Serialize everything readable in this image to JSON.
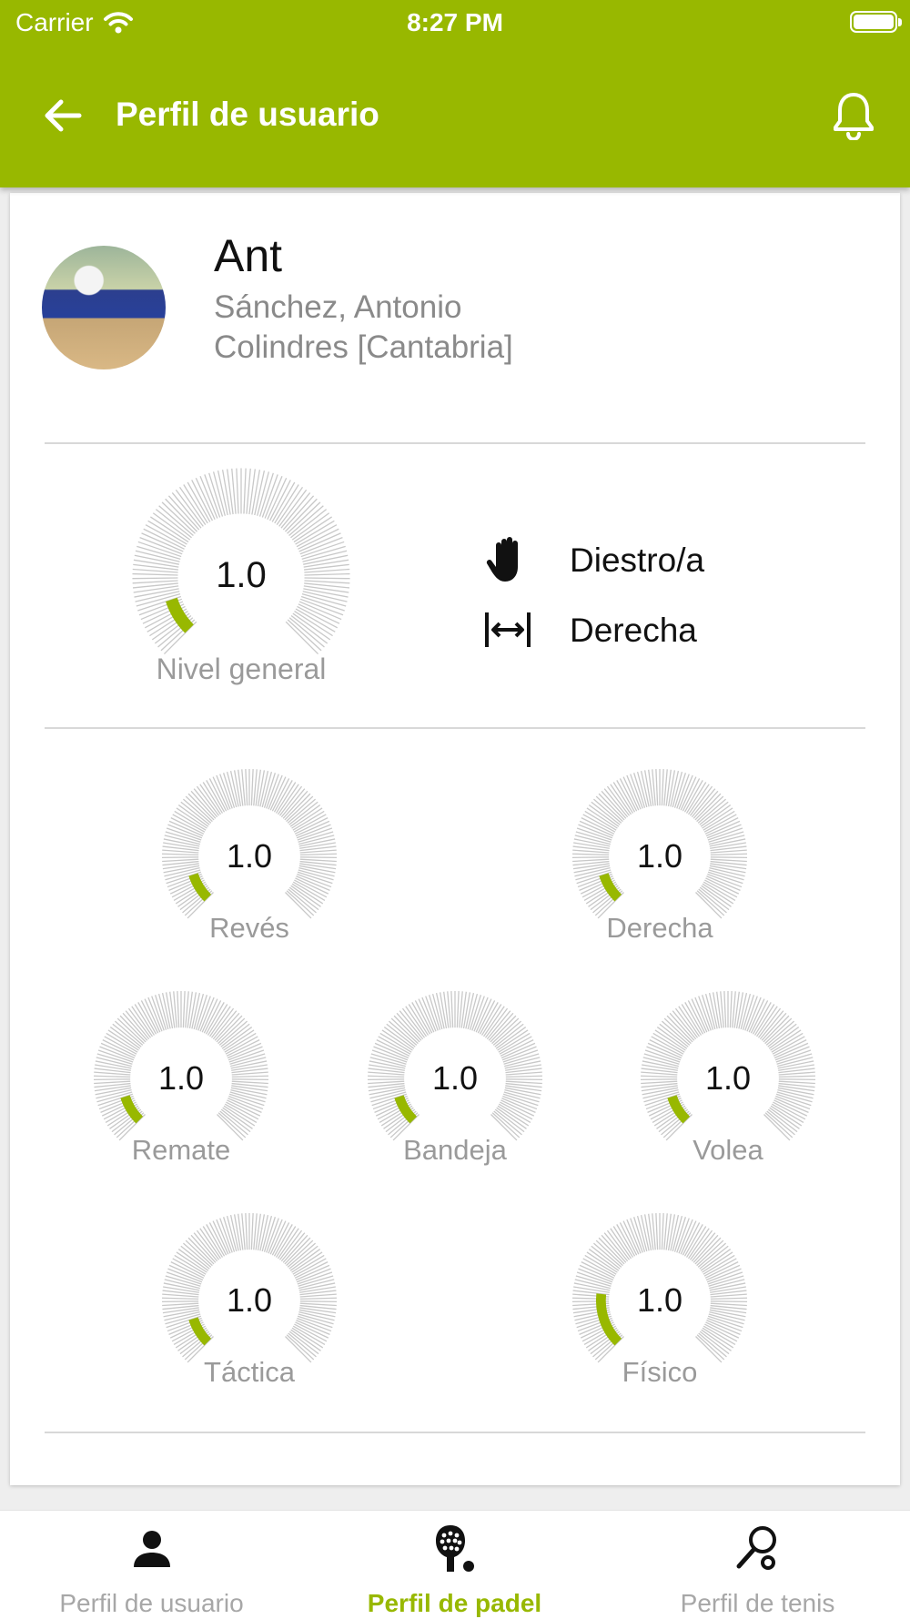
{
  "status_bar": {
    "carrier": "Carrier",
    "time": "8:27 PM"
  },
  "header": {
    "title": "Perfil de usuario"
  },
  "profile": {
    "username": "Ant",
    "full_name": "Sánchez, Antonio",
    "location": "Colindres [Cantabria]"
  },
  "overall": {
    "value": "1.0",
    "label": "Nivel general",
    "level": 0.1
  },
  "attributes": {
    "hand": {
      "icon": "hand-icon",
      "label": "Diestro/a"
    },
    "side": {
      "icon": "court-side-icon",
      "label": "Derecha"
    }
  },
  "skills": [
    {
      "value": "1.0",
      "label": "Revés",
      "level": 0.1
    },
    {
      "value": "1.0",
      "label": "Derecha",
      "level": 0.1
    },
    {
      "value": "1.0",
      "label": "Remate",
      "level": 0.1
    },
    {
      "value": "1.0",
      "label": "Bandeja",
      "level": 0.1
    },
    {
      "value": "1.0",
      "label": "Volea",
      "level": 0.1
    },
    {
      "value": "1.0",
      "label": "Táctica",
      "level": 0.1
    },
    {
      "value": "1.0",
      "label": "Físico",
      "level": 0.19
    }
  ],
  "tabs": [
    {
      "label": "Perfil de usuario",
      "icon": "person-icon",
      "active": false
    },
    {
      "label": "Perfil de padel",
      "icon": "padel-racket-icon",
      "active": true
    },
    {
      "label": "Perfil de tenis",
      "icon": "tennis-racket-icon",
      "active": false
    }
  ],
  "colors": {
    "accent": "#98b800",
    "gauge_track": "#c8c8c8",
    "muted_text": "#9a9a9a"
  }
}
